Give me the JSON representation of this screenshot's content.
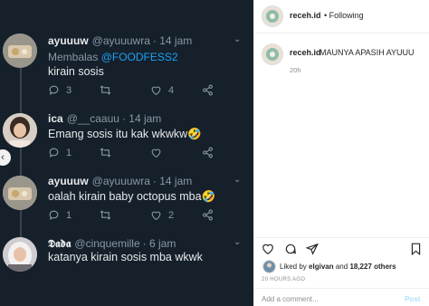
{
  "post_image": {
    "tweets": [
      {
        "name": "ayuuuw",
        "handle": "@ayuuuwra",
        "time": "14 jam",
        "reply_prefix": "Membalas",
        "reply_mention": "@FOODFESS2",
        "text": "kirain sosis",
        "replies": "3",
        "retweets": "",
        "likes": "4"
      },
      {
        "name": "ica",
        "handle": "@__caauu",
        "time": "14 jam",
        "reply_prefix": "",
        "reply_mention": "",
        "text": "Emang sosis itu kak wkwkw🤣",
        "replies": "1",
        "retweets": "",
        "likes": ""
      },
      {
        "name": "ayuuuw",
        "handle": "@ayuuuwra",
        "time": "14 jam",
        "reply_prefix": "",
        "reply_mention": "",
        "text": "oalah kirain baby octopus mba🤣",
        "replies": "1",
        "retweets": "",
        "likes": "2"
      },
      {
        "name": "𝕯𝖆𝖉𝖆",
        "handle": "@cinquemille",
        "time": "6 jam",
        "reply_prefix": "",
        "reply_mention": "",
        "text": "katanya kirain sosis mba wkwk",
        "replies": "",
        "retweets": "",
        "likes": ""
      }
    ],
    "separator": "·",
    "caret_icon": "chevron-down-icon"
  },
  "instagram": {
    "username": "receh.id",
    "following": "• Following",
    "caption": "MAUNYA APASIH AYUUU",
    "caption_time": "20h",
    "likes_prefix": "Liked by",
    "likes_user": "elgivan",
    "likes_and": "and",
    "likes_count": "18,227 others",
    "time_ago": "20 HOURS AGO",
    "comment_placeholder": "Add a comment...",
    "post_button": "Post",
    "more_icon": "more-dots-icon"
  },
  "colors": {
    "twitter_bg": "#15202b",
    "twitter_text": "#e6e9ea",
    "twitter_muted": "#8899a6",
    "twitter_link": "#1da1f2",
    "ig_text": "#262626",
    "ig_muted": "#8e8e8e"
  }
}
